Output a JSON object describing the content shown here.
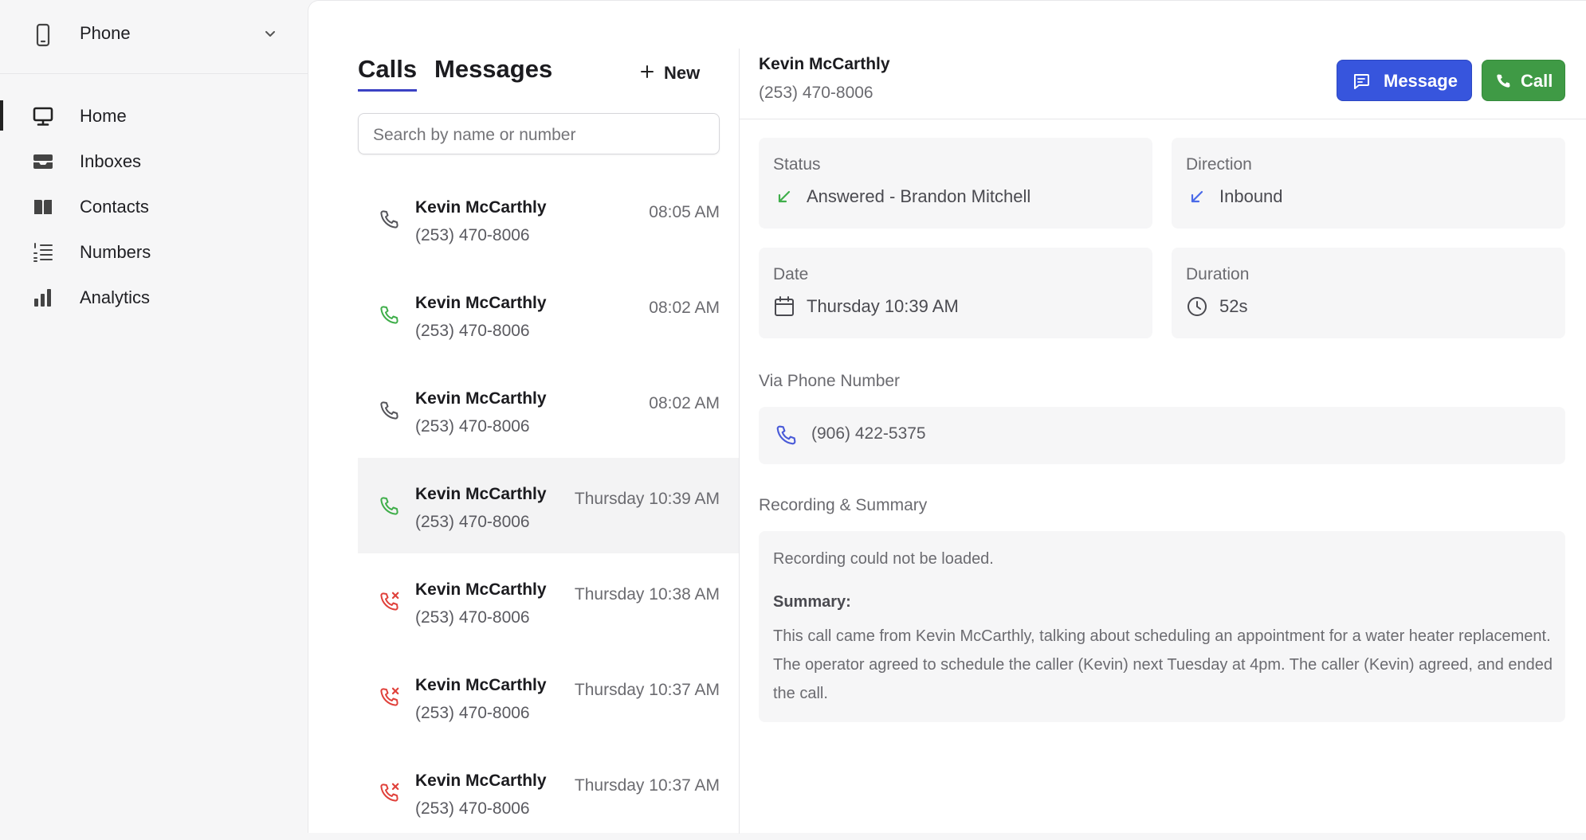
{
  "sidebar": {
    "app_switcher": {
      "label": "Phone",
      "icon": "smartphone-icon"
    },
    "items": [
      {
        "label": "Home",
        "icon": "monitor-icon",
        "active": true
      },
      {
        "label": "Inboxes",
        "icon": "inbox-icon",
        "active": false
      },
      {
        "label": "Contacts",
        "icon": "book-icon",
        "active": false
      },
      {
        "label": "Numbers",
        "icon": "list-numbered-icon",
        "active": false
      },
      {
        "label": "Analytics",
        "icon": "bar-chart-icon",
        "active": false
      }
    ]
  },
  "list": {
    "tabs": [
      {
        "label": "Calls",
        "active": true
      },
      {
        "label": "Messages",
        "active": false
      }
    ],
    "new_label": "New",
    "search_placeholder": "Search by name or number",
    "calls": [
      {
        "name": "Kevin McCarthly",
        "number": "(253) 470-8006",
        "time": "08:05 AM",
        "status": "neutral"
      },
      {
        "name": "Kevin McCarthly",
        "number": "(253) 470-8006",
        "time": "08:02 AM",
        "status": "answered"
      },
      {
        "name": "Kevin McCarthly",
        "number": "(253) 470-8006",
        "time": "08:02 AM",
        "status": "neutral"
      },
      {
        "name": "Kevin McCarthly",
        "number": "(253) 470-8006",
        "time": "Thursday 10:39 AM",
        "status": "answered",
        "selected": true
      },
      {
        "name": "Kevin McCarthly",
        "number": "(253) 470-8006",
        "time": "Thursday 10:38 AM",
        "status": "missed"
      },
      {
        "name": "Kevin McCarthly",
        "number": "(253) 470-8006",
        "time": "Thursday 10:37 AM",
        "status": "missed"
      },
      {
        "name": "Kevin McCarthly",
        "number": "(253) 470-8006",
        "time": "Thursday 10:37 AM",
        "status": "missed"
      }
    ]
  },
  "detail": {
    "name": "Kevin McCarthly",
    "number": "(253) 470-8006",
    "message_button": "Message",
    "call_button": "Call",
    "status": {
      "label": "Status",
      "value": "Answered - Brandon Mitchell"
    },
    "direction": {
      "label": "Direction",
      "value": "Inbound"
    },
    "date": {
      "label": "Date",
      "value": "Thursday 10:39 AM"
    },
    "duration": {
      "label": "Duration",
      "value": "52s"
    },
    "via": {
      "label": "Via Phone Number",
      "value": "(906) 422-5375"
    },
    "recording": {
      "label": "Recording & Summary",
      "message": "Recording could not be loaded.",
      "summary_label": "Summary:",
      "summary": "This call came from Kevin McCarthly, talking about scheduling an appointment for a water heater replacement. The operator agreed to schedule the caller (Kevin) next Tuesday at 4pm. The caller (Kevin) agreed, and ended the call."
    }
  },
  "colors": {
    "accent": "#3b42c4",
    "message_button": "#3755dd",
    "call_button": "#3f9a45",
    "answered": "#3fae4a",
    "missed": "#e0413b",
    "neutral": "#55555a",
    "inbound": "#4a6ae8"
  }
}
